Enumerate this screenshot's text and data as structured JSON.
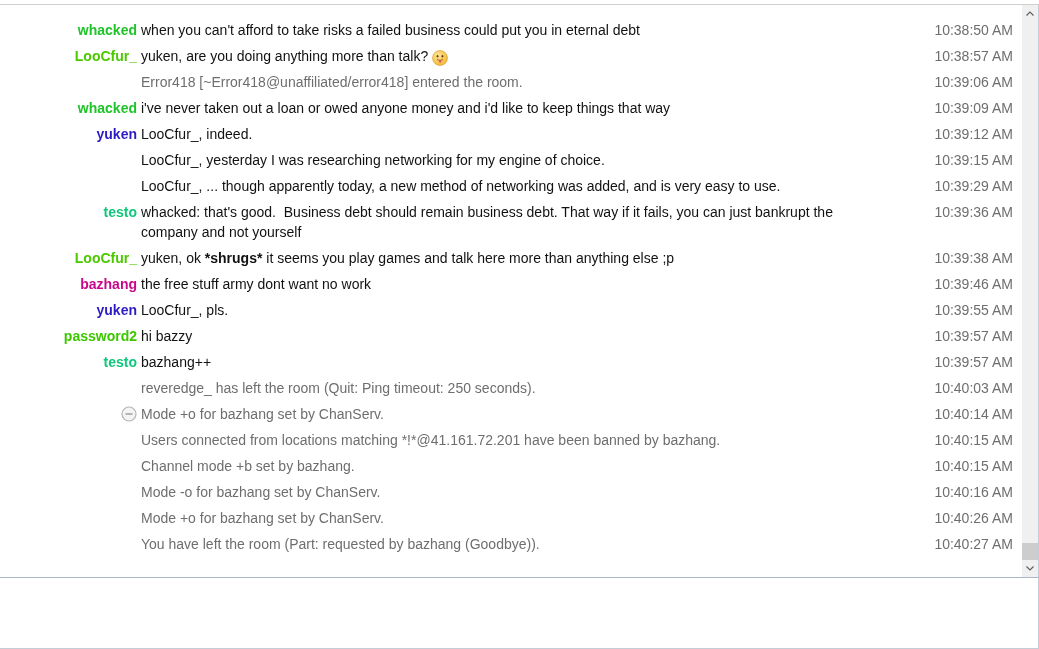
{
  "log": {
    "messages": [
      {
        "kind": "message",
        "nick": "whacked",
        "color": "#1ec428",
        "text": "when you can't afford to take risks a failed business could put you in eternal debt",
        "time": "10:38:50 AM"
      },
      {
        "kind": "message",
        "nick": "LooCfur_",
        "color": "#4cc800",
        "text": "yuken, are you doing anything more than talk?",
        "trailing_emoji": true,
        "time": "10:38:57 AM"
      },
      {
        "kind": "event",
        "text": "Error418 [~Error418@unaffiliated/error418] entered the room.",
        "time": "10:39:06 AM"
      },
      {
        "kind": "message",
        "nick": "whacked",
        "color": "#1ec428",
        "text": "i've never taken out a loan or owed anyone money and i'd like to keep things that way",
        "time": "10:39:09 AM"
      },
      {
        "kind": "message",
        "nick": "yuken",
        "color": "#2c1cc4",
        "text": "LooCfur_, indeed.",
        "time": "10:39:12 AM"
      },
      {
        "kind": "message",
        "text": "LooCfur_, yesterday I was researching networking for my engine of choice.",
        "time": "10:39:15 AM"
      },
      {
        "kind": "message",
        "text": "LooCfur_, ... though apparently today, a new method of networking was added, and is very easy to use.",
        "time": "10:39:29 AM"
      },
      {
        "kind": "message",
        "nick": "testo",
        "color": "#10c87c",
        "text": "whacked: that's good.  Business debt should remain business debt. That way if it fails, you can just bankrupt the company and not yourself",
        "time": "10:39:36 AM"
      },
      {
        "kind": "message",
        "nick": "LooCfur_",
        "color": "#4cc800",
        "parts": [
          {
            "text": "yuken, ok ",
            "bold": false
          },
          {
            "text": "*shrugs*",
            "bold": true
          },
          {
            "text": " it seems you play games and talk here more than anything else ;p",
            "bold": false
          }
        ],
        "time": "10:39:38 AM"
      },
      {
        "kind": "message",
        "nick": "bazhang",
        "color": "#c8088c",
        "text": "the free stuff army dont want no work",
        "time": "10:39:46 AM"
      },
      {
        "kind": "message",
        "nick": "yuken",
        "color": "#2c1cc4",
        "text": "LooCfur_, pls.",
        "time": "10:39:55 AM"
      },
      {
        "kind": "message",
        "nick": "password2",
        "color": "#3cc800",
        "text": "hi bazzy",
        "time": "10:39:57 AM"
      },
      {
        "kind": "message",
        "nick": "testo",
        "color": "#10c87c",
        "text": "bazhang++",
        "time": "10:39:57 AM"
      },
      {
        "kind": "event",
        "text": "reveredge_ has left the room (Quit: Ping timeout: 250 seconds).",
        "time": "10:40:03 AM"
      },
      {
        "kind": "event",
        "group_toggle": {
          "expanded": true
        },
        "text": "Mode +o for bazhang set by ChanServ.",
        "time": "10:40:14 AM"
      },
      {
        "kind": "event",
        "text": "Users connected from locations matching *!*@41.161.72.201 have been banned by bazhang.",
        "time": "10:40:15 AM"
      },
      {
        "kind": "event",
        "text": "Channel mode +b set by bazhang.",
        "time": "10:40:15 AM"
      },
      {
        "kind": "event",
        "text": "Mode -o for bazhang set by ChanServ.",
        "time": "10:40:16 AM"
      },
      {
        "kind": "event",
        "text": "Mode +o for bazhang set by ChanServ.",
        "time": "10:40:26 AM"
      },
      {
        "kind": "event",
        "text": "You have left the room (Part: requested by bazhang (Goodbye)).",
        "time": "10:40:27 AM"
      }
    ]
  }
}
